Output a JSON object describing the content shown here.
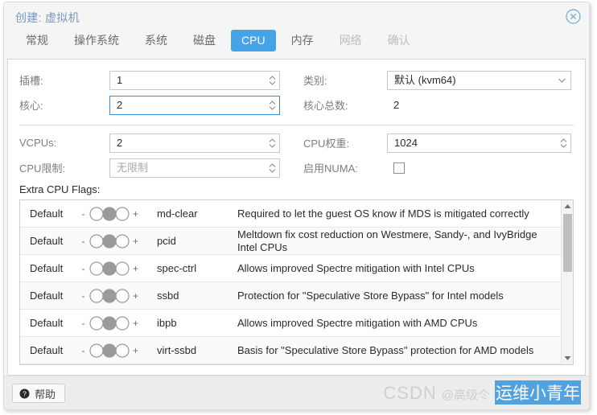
{
  "window": {
    "title": "创建: 虚拟机",
    "close_icon": "close-circle-icon"
  },
  "tabs": [
    {
      "label": "常规",
      "state": "normal"
    },
    {
      "label": "操作系统",
      "state": "normal"
    },
    {
      "label": "系统",
      "state": "normal"
    },
    {
      "label": "磁盘",
      "state": "normal"
    },
    {
      "label": "CPU",
      "state": "active"
    },
    {
      "label": "内存",
      "state": "normal"
    },
    {
      "label": "网络",
      "state": "disabled"
    },
    {
      "label": "确认",
      "state": "disabled"
    }
  ],
  "form": {
    "sockets": {
      "label": "插槽:",
      "value": "1"
    },
    "cores": {
      "label": "核心:",
      "value": "2",
      "focused": true
    },
    "type": {
      "label": "类别:",
      "value": "默认 (kvm64)"
    },
    "total": {
      "label": "核心总数:",
      "value": "2"
    },
    "vcpus": {
      "label": "VCPUs:",
      "value": "2"
    },
    "cpu_units": {
      "label": "CPU权重:",
      "value": "1024"
    },
    "cpu_limit": {
      "label": "CPU限制:",
      "placeholder": "无限制",
      "value": ""
    },
    "numa": {
      "label": "启用NUMA:",
      "checked": false
    }
  },
  "flags": {
    "section_label": "Extra CPU Flags:",
    "rows": [
      {
        "state": "Default",
        "name": "md-clear",
        "desc": "Required to let the guest OS know if MDS is mitigated correctly"
      },
      {
        "state": "Default",
        "name": "pcid",
        "desc": "Meltdown fix cost reduction on Westmere, Sandy-, and IvyBridge Intel CPUs"
      },
      {
        "state": "Default",
        "name": "spec-ctrl",
        "desc": "Allows improved Spectre mitigation with Intel CPUs"
      },
      {
        "state": "Default",
        "name": "ssbd",
        "desc": "Protection for \"Speculative Store Bypass\" for Intel models"
      },
      {
        "state": "Default",
        "name": "ibpb",
        "desc": "Allows improved Spectre mitigation with AMD CPUs"
      },
      {
        "state": "Default",
        "name": "virt-ssbd",
        "desc": "Basis for \"Speculative Store Bypass\" protection for AMD models"
      }
    ],
    "minus_label": "-",
    "plus_label": "+"
  },
  "footer": {
    "help_label": "帮助",
    "help_icon": "question-circle-icon"
  },
  "watermark": {
    "brand": "CSDN",
    "at": "@高级仒",
    "name": "运维小青年"
  },
  "colors": {
    "accent": "#45a3e8",
    "focus_border": "#3a8ed0",
    "title": "#7a98b8",
    "panel_bg": "#ffffff",
    "chrome_bg": "#f5f5f5",
    "footer_bg": "#ededed"
  }
}
